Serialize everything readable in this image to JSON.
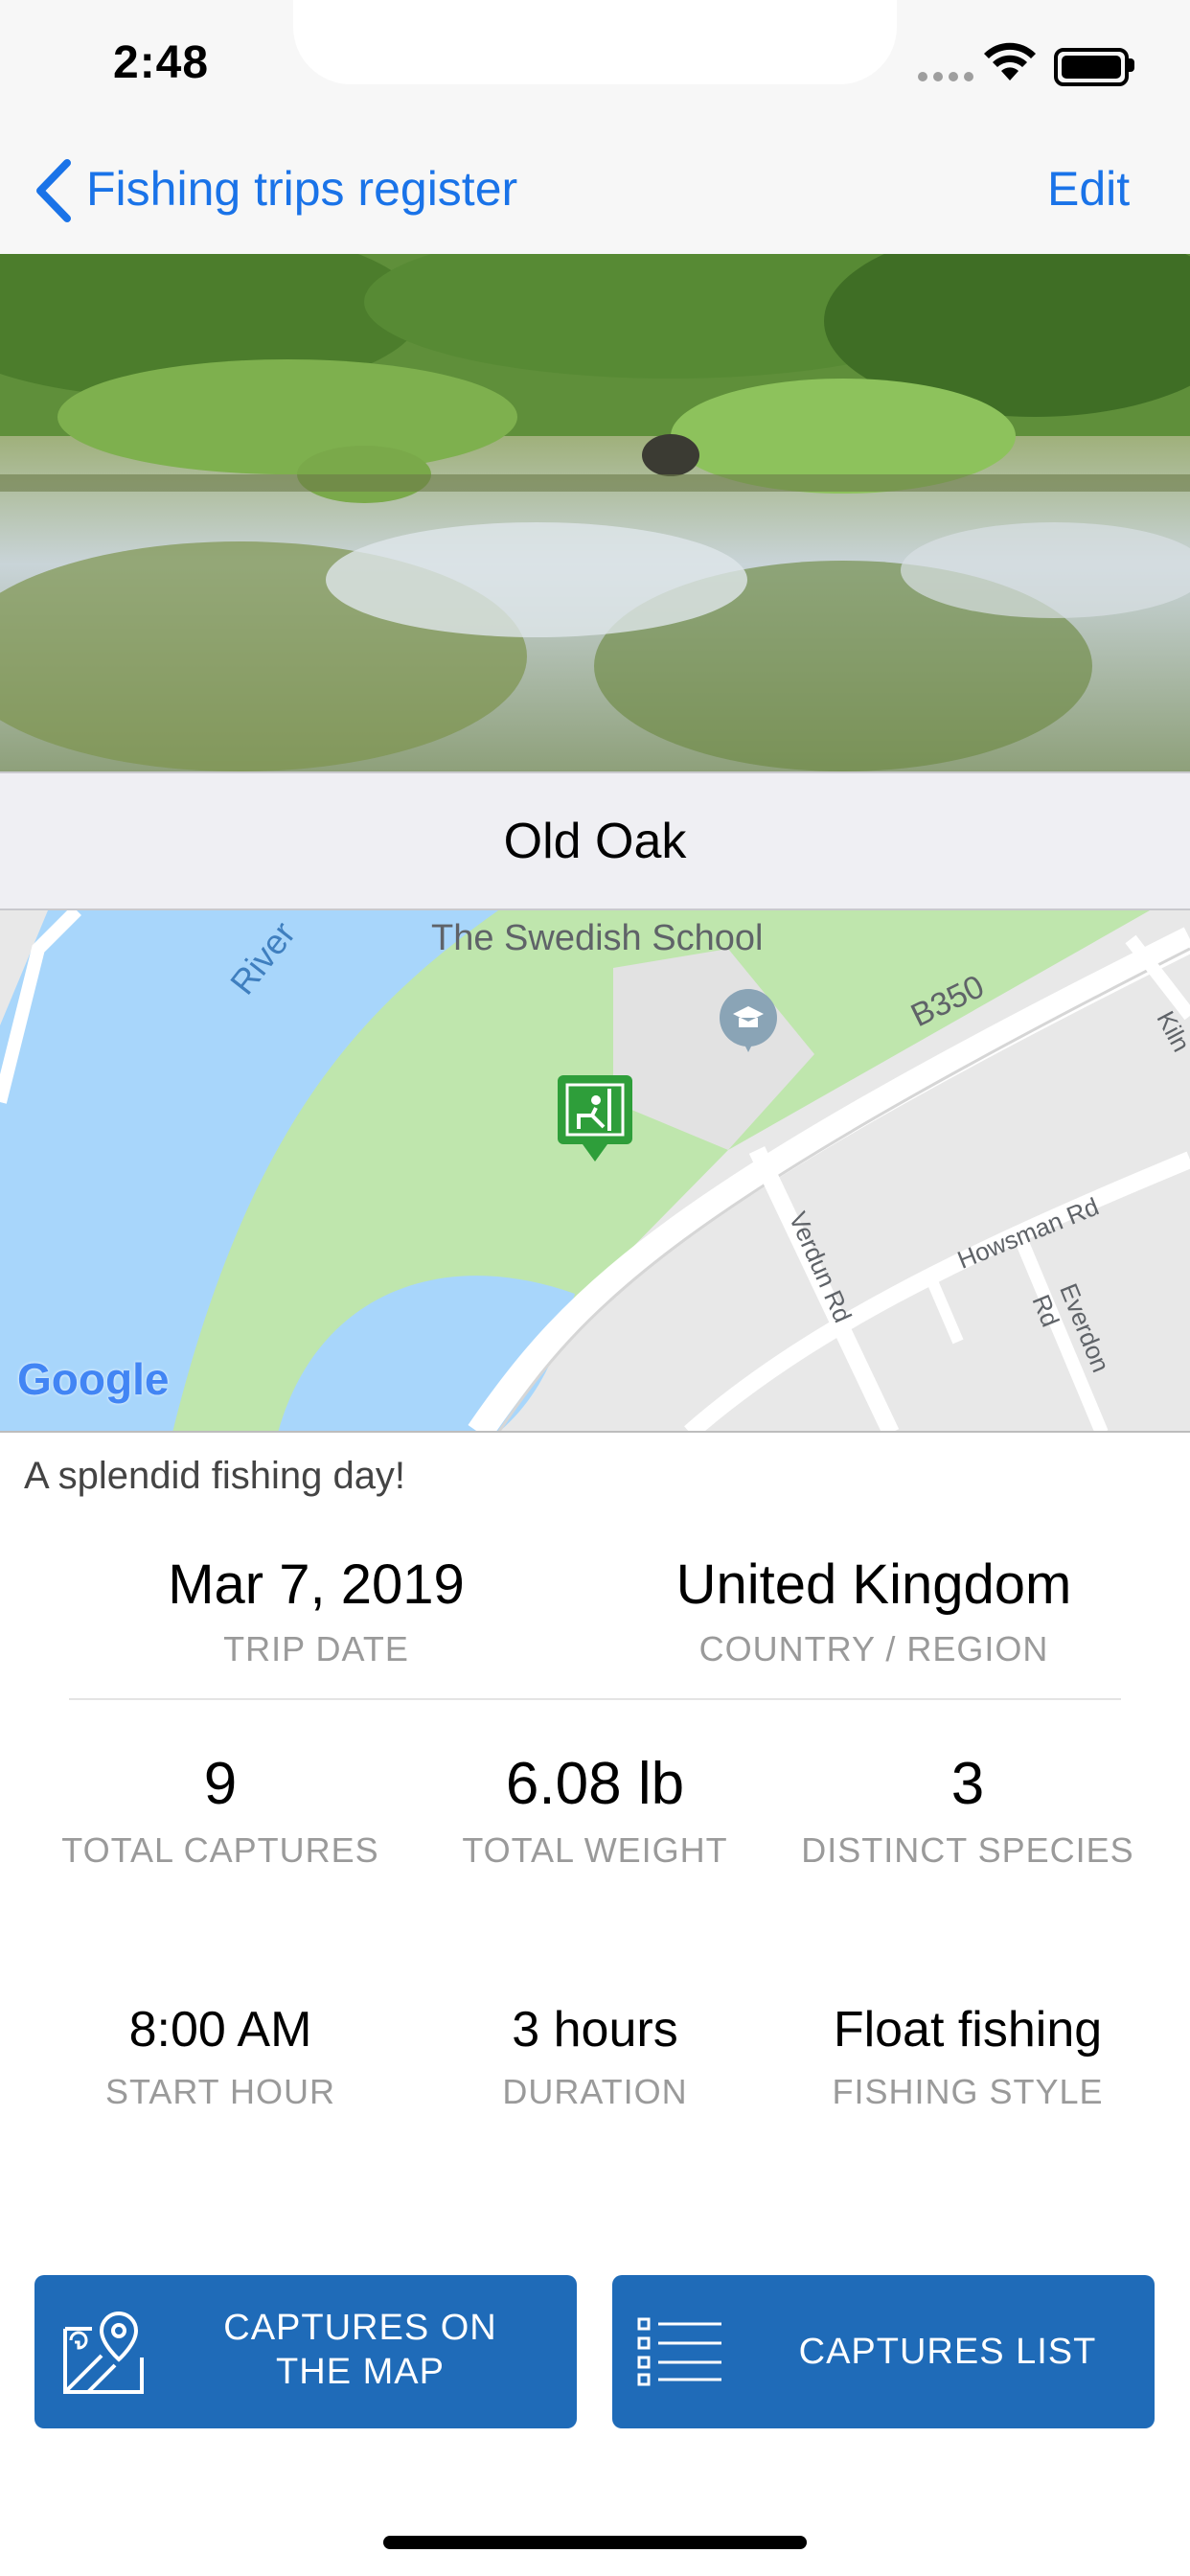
{
  "status_bar": {
    "time": "2:48"
  },
  "nav": {
    "back_label": "Fishing trips register",
    "edit_label": "Edit"
  },
  "spot": {
    "title": "Old Oak"
  },
  "map": {
    "labels": {
      "school": "The Swedish School",
      "river": "River",
      "road_b350": "B350",
      "howsman": "Howsman Rd",
      "verdun": "Verdun Rd",
      "everdon": "Everdon Rd",
      "kiln": "Kiln",
      "google": "Google"
    }
  },
  "trip": {
    "note": "A splendid fishing day!",
    "date": {
      "value": "Mar 7, 2019",
      "label": "TRIP DATE"
    },
    "country": {
      "value": "United Kingdom",
      "label": "COUNTRY / REGION"
    },
    "captures": {
      "value": "9",
      "label": "TOTAL CAPTURES"
    },
    "weight": {
      "value": "6.08 lb",
      "label": "TOTAL WEIGHT"
    },
    "species": {
      "value": "3",
      "label": "DISTINCT SPECIES"
    },
    "start": {
      "value": "8:00 AM",
      "label": "START HOUR"
    },
    "duration": {
      "value": "3 hours",
      "label": "DURATION"
    },
    "style": {
      "value": "Float fishing",
      "label": "FISHING STYLE"
    }
  },
  "buttons": {
    "map_line1": "CAPTURES ON",
    "map_line2": "THE MAP",
    "list": "CAPTURES LIST"
  },
  "colors": {
    "accent": "#1a73e8",
    "button": "#1f6bb8",
    "label_gray": "#9a9a9a"
  }
}
